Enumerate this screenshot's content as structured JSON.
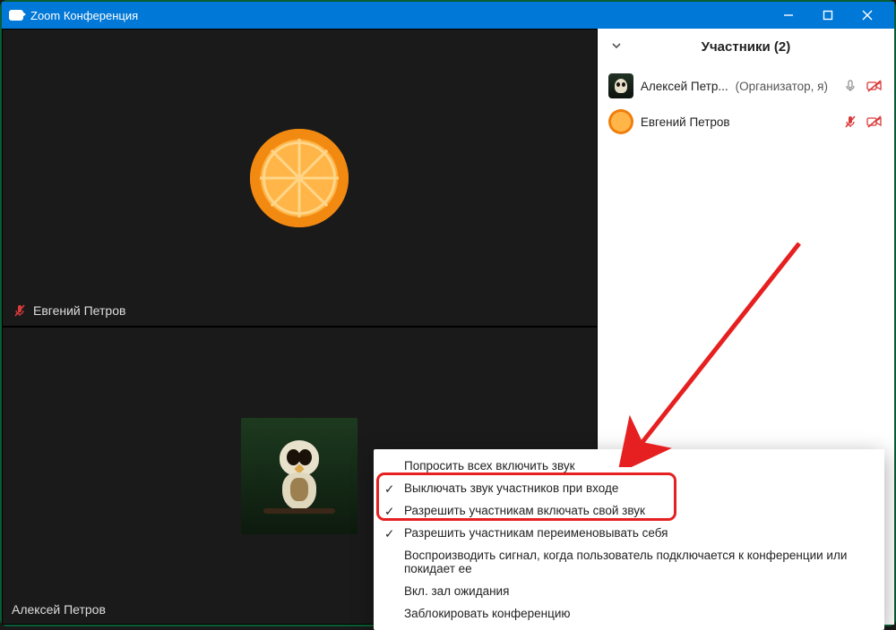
{
  "window": {
    "title": "Zoom Конференция"
  },
  "video_tiles": [
    {
      "name": "Евгений Петров",
      "muted": true
    },
    {
      "name": "Алексей Петров",
      "muted": false
    }
  ],
  "participants": {
    "header": "Участники (2)",
    "items": [
      {
        "name": "Алексей Петр...",
        "tag": "(Организатор, я)",
        "mic": "muted",
        "cam": "off"
      },
      {
        "name": "Евгений Петров",
        "tag": "",
        "mic": "muted-red",
        "cam": "off"
      }
    ]
  },
  "context_menu": {
    "items": [
      {
        "label": "Попросить всех включить звук",
        "checked": false
      },
      {
        "label": "Выключать звук участников при входе",
        "checked": true
      },
      {
        "label": "Разрешить участникам включать свой звук",
        "checked": true
      },
      {
        "label": "Разрешить участникам переименовывать себя",
        "checked": true
      },
      {
        "label": "Воспроизводить сигнал, когда пользователь подключается к конференции или покидает ее",
        "checked": false
      },
      {
        "label": "Вкл. зал ожидания",
        "checked": false
      },
      {
        "label": "Заблокировать конференцию",
        "checked": false
      }
    ]
  },
  "colors": {
    "accent": "#0078d7",
    "danger": "#e62020",
    "mic_muted": "#d93a3a"
  }
}
